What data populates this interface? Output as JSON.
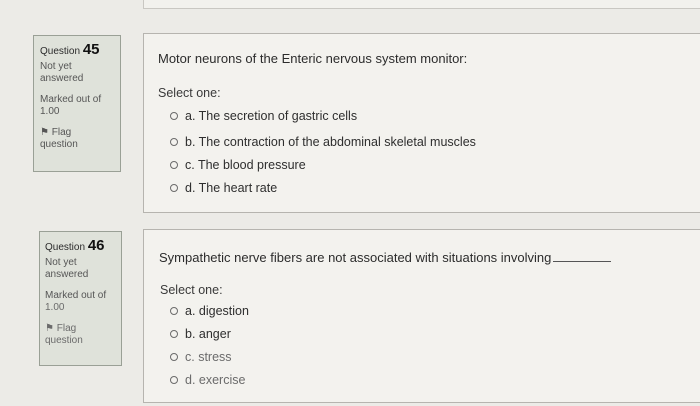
{
  "questions": [
    {
      "question_label": "Question",
      "number": "45",
      "status_line1": "Not yet",
      "status_line2": "answered",
      "marked_line1": "Marked out of",
      "marked_line2": "1.00",
      "flag_line1": "Flag",
      "flag_line2": "question",
      "text": "Motor neurons of the Enteric nervous system monitor:",
      "select_label": "Select one:",
      "options": [
        "a. The secretion of gastric cells",
        "b. The contraction of the abdominal skeletal muscles",
        "c. The blood pressure",
        "d. The heart rate"
      ]
    },
    {
      "question_label": "Question",
      "number": "46",
      "status_line1": "Not yet",
      "status_line2": "answered",
      "marked_line1": "Marked out of",
      "marked_line2": "1.00",
      "flag_line1": "Flag",
      "flag_line2": "question",
      "text": "Sympathetic nerve fibers are not associated with situations involving",
      "select_label": "Select one:",
      "options": [
        "a. digestion",
        "b. anger",
        "c. stress",
        "d. exercise"
      ]
    }
  ],
  "icons": {
    "flag": "flag-icon",
    "radio": "radio-icon"
  },
  "colors": {
    "info_bg": "#dfe2da",
    "content_bg": "#f3f2ee",
    "page_bg": "#ecebe7"
  }
}
